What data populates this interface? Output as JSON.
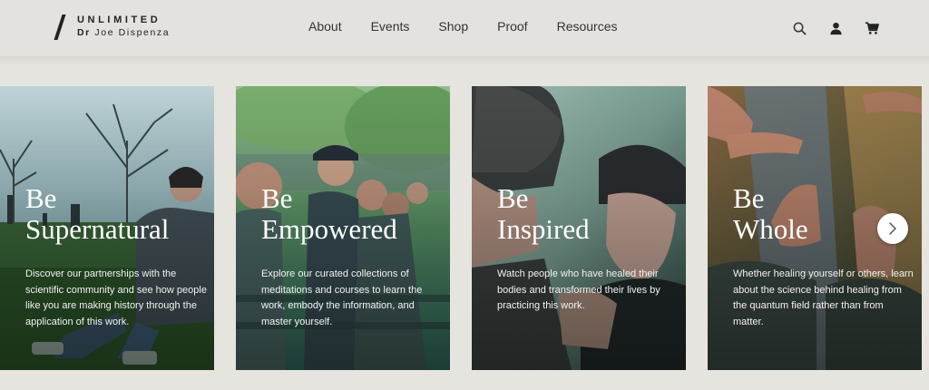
{
  "brand": {
    "top": "UNLIMITED",
    "prefix": "Dr",
    "name": "Joe Dispenza"
  },
  "nav": [
    "About",
    "Events",
    "Shop",
    "Proof",
    "Resources"
  ],
  "tools": [
    "search-icon",
    "account-icon",
    "cart-icon"
  ],
  "cards": [
    {
      "title1": "Be",
      "title2": "Supernatural",
      "desc": "Discover our partnerships with the scientific community and see how people like you are making history through the application of this work."
    },
    {
      "title1": "Be",
      "title2": "Empowered",
      "desc": "Explore our curated collections of meditations and courses to learn the work, embody the information, and master yourself."
    },
    {
      "title1": "Be",
      "title2": "Inspired",
      "desc": "Watch people who have healed their bodies and transformed their lives by practicing this work."
    },
    {
      "title1": "Be",
      "title2": "Whole",
      "desc": "Whether healing yourself or others, learn about the science behind healing from the quantum field rather than from matter."
    }
  ],
  "carousel": {
    "next_icon": "chevron-right-icon"
  }
}
